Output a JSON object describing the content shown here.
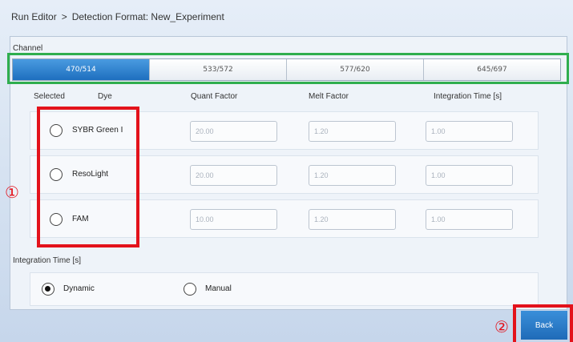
{
  "breadcrumb": {
    "parent": "Run Editor",
    "separator": ">",
    "current": "Detection Format: New_Experiment"
  },
  "channel": {
    "label": "Channel",
    "tabs": [
      "470/514",
      "533/572",
      "577/620",
      "645/697"
    ],
    "active_index": 0
  },
  "dye_table": {
    "headers": {
      "selected": "Selected",
      "dye": "Dye",
      "quant": "Quant Factor",
      "melt": "Melt Factor",
      "integration": "Integration Time [s]"
    },
    "rows": [
      {
        "name": "SYBR Green I",
        "selected": false,
        "quant": "20.00",
        "melt": "1.20",
        "integration": "1.00"
      },
      {
        "name": "ResoLight",
        "selected": false,
        "quant": "20.00",
        "melt": "1.20",
        "integration": "1.00"
      },
      {
        "name": "FAM",
        "selected": false,
        "quant": "10.00",
        "melt": "1.20",
        "integration": "1.00"
      }
    ]
  },
  "integration_time": {
    "label": "Integration Time [s]",
    "options": [
      {
        "label": "Dynamic",
        "selected": true
      },
      {
        "label": "Manual",
        "selected": false
      }
    ]
  },
  "annotations": {
    "marker1": "①",
    "marker2": "②"
  },
  "back_button": {
    "label": "Back"
  },
  "colors": {
    "accent": "#1e6fbf",
    "highlight_red": "#e3121b",
    "highlight_green": "#2fae4e"
  }
}
